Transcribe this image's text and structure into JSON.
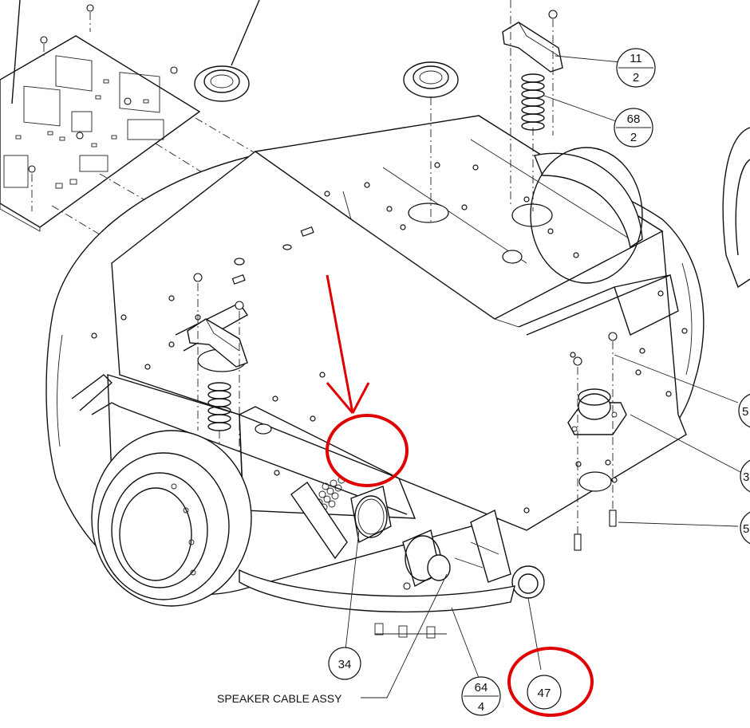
{
  "balloons": {
    "b11": {
      "top": "11",
      "bottom": "2"
    },
    "b68": {
      "top": "68",
      "bottom": "2"
    },
    "b64": {
      "top": "64",
      "bottom": "4"
    },
    "b34": "34",
    "b47": "47",
    "edge1": "5",
    "edge2": "3",
    "edge3": "5"
  },
  "callout": {
    "speaker_cable": "SPEAKER CABLE ASSY"
  },
  "colors": {
    "line": "#111111",
    "highlight": "#e00000"
  }
}
